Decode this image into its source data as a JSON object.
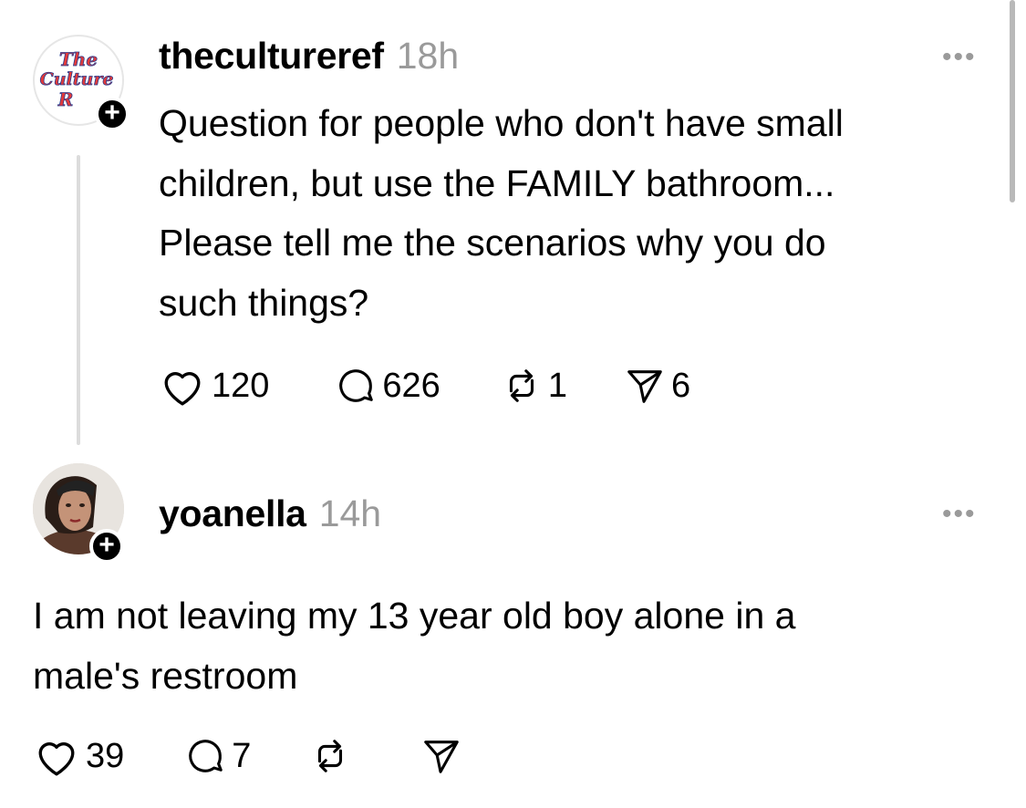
{
  "post": {
    "username": "thecultureref",
    "time": "18h",
    "avatar_text": [
      "The",
      "Culture",
      "R"
    ],
    "lines": [
      "Question for people who don't have small",
      "children, but use the FAMILY bathroom...",
      "Please tell me the scenarios why you do",
      "such things?"
    ],
    "likes": "120",
    "comments": "626",
    "reposts": "1",
    "shares": "6"
  },
  "reply": {
    "username": "yoanella",
    "time": "14h",
    "lines": [
      "I am not leaving my 13 year old boy alone in a",
      "male's restroom"
    ],
    "likes": "39",
    "comments": "7"
  },
  "more_glyph": "•••",
  "plus_glyph": "+"
}
